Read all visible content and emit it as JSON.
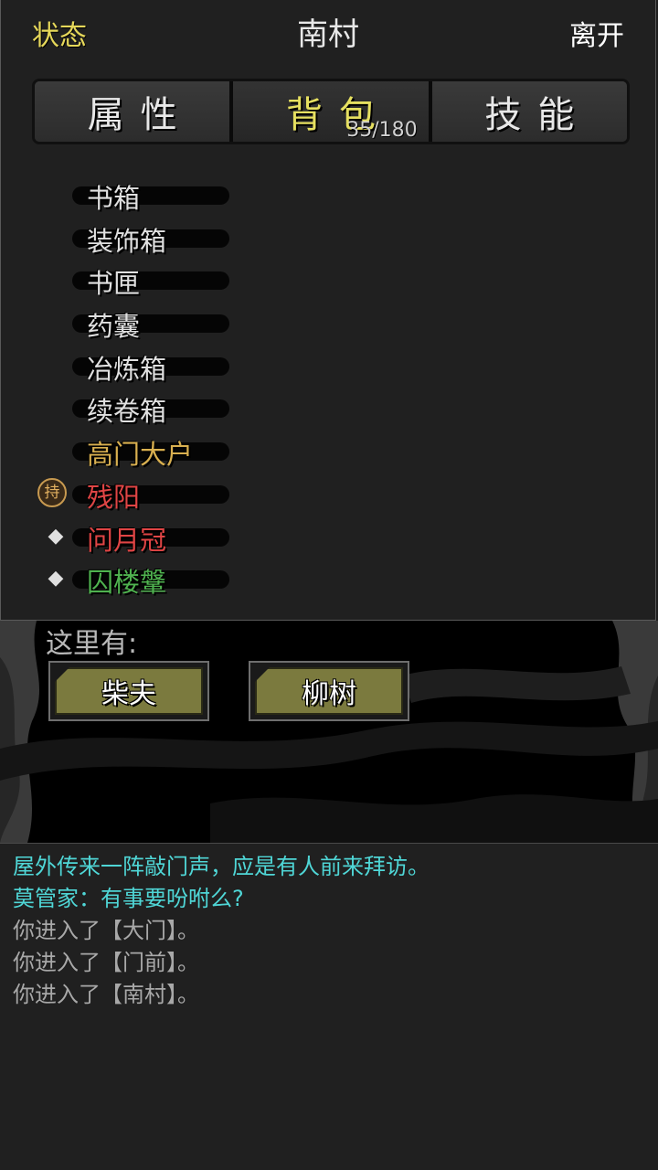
{
  "header": {
    "status_label": "状态",
    "location": "南村",
    "leave_label": "离开"
  },
  "tabs": [
    {
      "label": "属性",
      "active": false
    },
    {
      "label": "背包",
      "active": true,
      "count": "35/180"
    },
    {
      "label": "技能",
      "active": false
    }
  ],
  "items": [
    {
      "name": "书箱",
      "color": "#e0e0e0",
      "mark": ""
    },
    {
      "name": "装饰箱",
      "color": "#e0e0e0",
      "mark": ""
    },
    {
      "name": "书匣",
      "color": "#e0e0e0",
      "mark": ""
    },
    {
      "name": "药囊",
      "color": "#e0e0e0",
      "mark": ""
    },
    {
      "name": "冶炼箱",
      "color": "#e0e0e0",
      "mark": ""
    },
    {
      "name": "续卷箱",
      "color": "#e0e0e0",
      "mark": ""
    },
    {
      "name": "高门大户",
      "color": "#d9b050",
      "mark": ""
    },
    {
      "name": "残阳",
      "color": "#e04545",
      "mark": "持"
    },
    {
      "name": "问月冠",
      "color": "#e04545",
      "mark": "◆"
    },
    {
      "name": "囚楼鞶",
      "color": "#4fb24f",
      "mark": "◆"
    }
  ],
  "scene": {
    "here_label": "这里有:",
    "npcs": [
      "柴夫",
      "柳树"
    ]
  },
  "log": [
    {
      "text": "屋外传来一阵敲门声，应是有人前来拜访。",
      "color": "#4fd6d6"
    },
    {
      "text": "莫管家：有事要吩咐么?",
      "color": "#4fd6d6"
    },
    {
      "text": "你进入了【大门】。",
      "color": "#a8a8a8"
    },
    {
      "text": "你进入了【门前】。",
      "color": "#a8a8a8"
    },
    {
      "text": "你进入了【南村】。",
      "color": "#a8a8a8"
    }
  ]
}
